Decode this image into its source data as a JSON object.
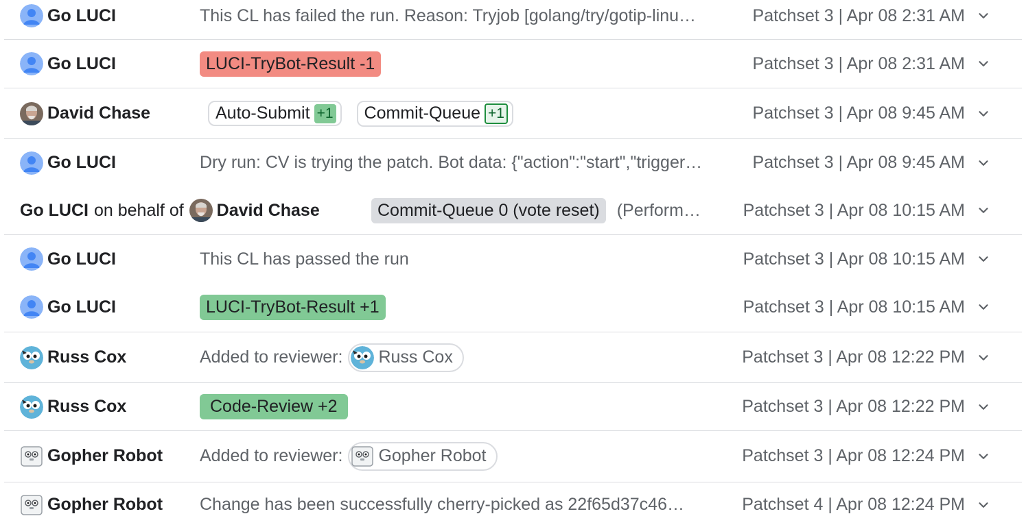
{
  "messages": [
    {
      "author": "Go LUCI",
      "content_text": "This CL has failed the run. Reason: Tryjob [golang/try/gotip-linu…",
      "meta": "Patchset 3 | Apr 08 2:31 AM"
    },
    {
      "author": "Go LUCI",
      "label": "LUCI-TryBot-Result -1",
      "label_color": "#f28b82",
      "meta": "Patchset 3 | Apr 08 2:31 AM"
    },
    {
      "author": "David Chase",
      "votes": [
        {
          "name": "Auto-Submit",
          "value": "+1"
        },
        {
          "name": "Commit-Queue",
          "value": "+1"
        }
      ],
      "meta": "Patchset 3 | Apr 08 9:45 AM"
    },
    {
      "author": "Go LUCI",
      "content_text": "Dry run: CV is trying the patch. Bot data: {\"action\":\"start\",\"trigger…",
      "meta": "Patchset 3 | Apr 08 9:45 AM"
    },
    {
      "author_prefix": "Go LUCI",
      "on_behalf_of": "on behalf of",
      "author": "David Chase",
      "label": "Commit-Queue 0 (vote reset)",
      "label_color": "#dadce0",
      "content_text": "(Perform…",
      "meta": "Patchset 3 | Apr 08 10:15 AM"
    },
    {
      "author": "Go LUCI",
      "content_text": "This CL has passed the run",
      "meta": "Patchset 3 | Apr 08 10:15 AM"
    },
    {
      "author": "Go LUCI",
      "label": "LUCI-TryBot-Result +1",
      "label_color": "#81c995",
      "meta": "Patchset 3 | Apr 08 10:15 AM"
    },
    {
      "author": "Russ Cox",
      "content_text": "Added to reviewer:",
      "reviewer": "Russ Cox",
      "meta": "Patchset 3 | Apr 08 12:22 PM"
    },
    {
      "author": "Russ Cox",
      "label": "Code-Review +2",
      "label_color": "#81c995",
      "meta": "Patchset 3 | Apr 08 12:22 PM"
    },
    {
      "author": "Gopher Robot",
      "content_text": "Added to reviewer:",
      "reviewer": "Gopher Robot",
      "meta": "Patchset 3 | Apr 08 12:24 PM"
    },
    {
      "author": "Gopher Robot",
      "content_text": "Change has been successfully cherry-picked as 22f65d37c46…",
      "meta": "Patchset 4 | Apr 08 12:24 PM"
    }
  ],
  "icons": {
    "default_avatar": "person-avatar-icon",
    "david_chase_avatar": "photo-avatar-icon",
    "russ_cox_avatar": "gopher-avatar-icon",
    "gopher_robot_avatar": "robot-avatar-icon",
    "expand": "chevron-down-icon"
  },
  "colors": {
    "accent_blue": "#8ab4f8",
    "divider": "#dadce0",
    "secondary_text": "#5f6368"
  }
}
